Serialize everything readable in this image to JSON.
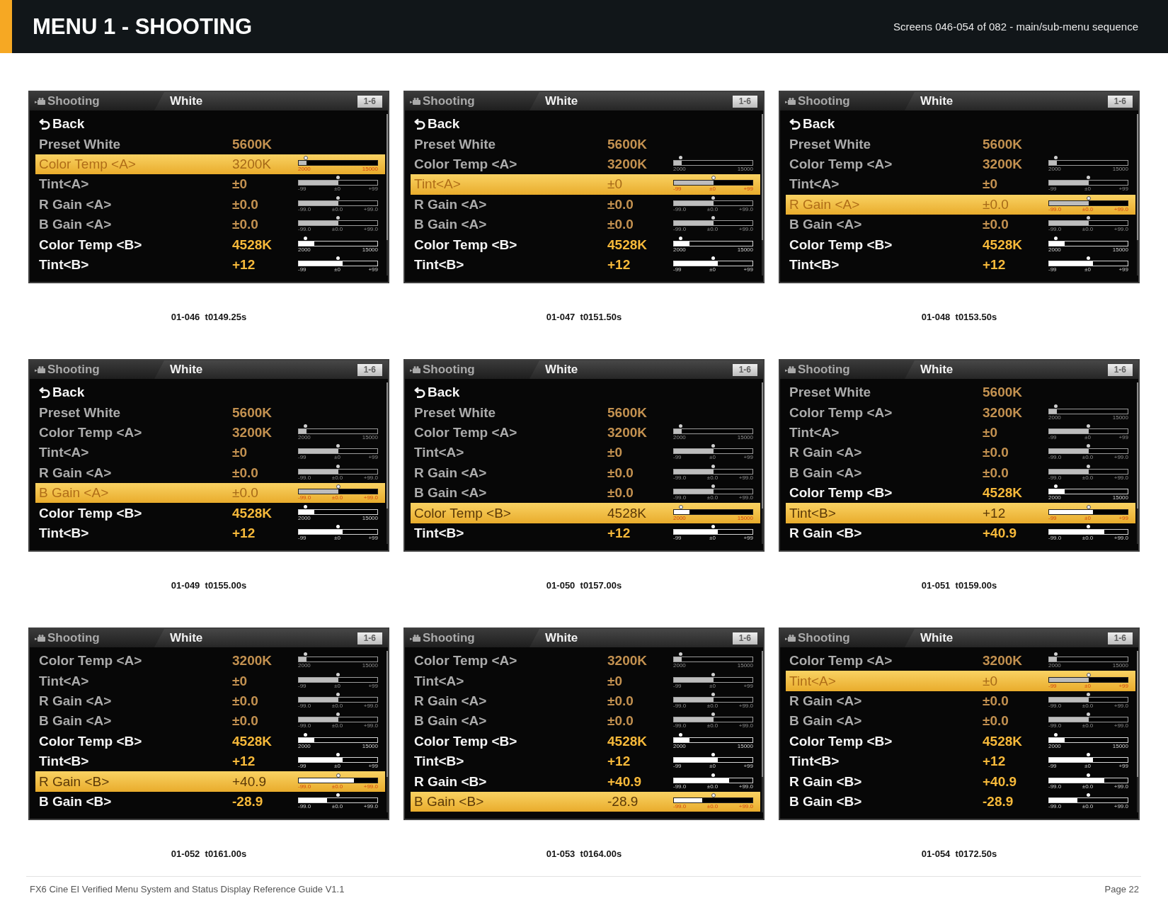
{
  "header": {
    "title": "MENU 1 - SHOOTING",
    "subtitle": "Screens 046-054 of 082 - main/sub-menu sequence"
  },
  "screens": [
    {
      "breadcrumb": "Shooting",
      "title": "White",
      "page": "1-6",
      "caption": "01-046  t0149.25s",
      "rows": [
        {
          "kind": "back",
          "label": "Back",
          "disabled": false,
          "selected": false
        },
        {
          "kind": "setting",
          "label": "Preset White",
          "value": "5600K",
          "disabled": true,
          "selected": false
        },
        {
          "kind": "setting",
          "label": "Color Temp <A>",
          "value": "3200K",
          "disabled": true,
          "selected": true,
          "slider": {
            "level": 0.1,
            "marker": {
              "level": 0.1
            },
            "ticks": [
              "2000",
              "15000"
            ]
          }
        },
        {
          "kind": "setting",
          "label": "Tint<A>",
          "value": "±0",
          "disabled": true,
          "selected": false,
          "slider": {
            "level": 0.5,
            "marker": {
              "level": 0.5
            },
            "ticks": [
              "-99",
              "±0",
              "+99"
            ]
          }
        },
        {
          "kind": "setting",
          "label": "R Gain <A>",
          "value": "±0.0",
          "disabled": true,
          "selected": false,
          "slider": {
            "level": 0.5,
            "marker": {
              "level": 0.5
            },
            "ticks": [
              "-99.0",
              "±0.0",
              "+99.0"
            ]
          }
        },
        {
          "kind": "setting",
          "label": "B Gain <A>",
          "value": "±0.0",
          "disabled": true,
          "selected": false,
          "slider": {
            "level": 0.5,
            "marker": {
              "level": 0.5
            },
            "ticks": [
              "-99.0",
              "±0.0",
              "+99.0"
            ]
          }
        },
        {
          "kind": "setting",
          "label": "Color Temp <B>",
          "value": "4528K",
          "disabled": false,
          "selected": false,
          "slider": {
            "level": 0.2,
            "marker": {
              "level": 0.1
            },
            "ticks": [
              "2000",
              "15000"
            ]
          }
        },
        {
          "kind": "setting",
          "label": "Tint<B>",
          "value": "+12",
          "disabled": false,
          "selected": false,
          "slider": {
            "level": 0.56,
            "marker": {
              "level": 0.5
            },
            "ticks": [
              "-99",
              "±0",
              "+99"
            ]
          }
        }
      ]
    },
    {
      "breadcrumb": "Shooting",
      "title": "White",
      "page": "1-6",
      "caption": "01-047  t0151.50s",
      "rows": [
        {
          "kind": "back",
          "label": "Back",
          "disabled": false,
          "selected": false
        },
        {
          "kind": "setting",
          "label": "Preset White",
          "value": "5600K",
          "disabled": true,
          "selected": false
        },
        {
          "kind": "setting",
          "label": "Color Temp <A>",
          "value": "3200K",
          "disabled": true,
          "selected": false,
          "slider": {
            "level": 0.1,
            "marker": {
              "level": 0.1
            },
            "ticks": [
              "2000",
              "15000"
            ]
          }
        },
        {
          "kind": "setting",
          "label": "Tint<A>",
          "value": "±0",
          "disabled": true,
          "selected": true,
          "slider": {
            "level": 0.5,
            "marker": {
              "level": 0.5
            },
            "ticks": [
              "-99",
              "±0",
              "+99"
            ]
          }
        },
        {
          "kind": "setting",
          "label": "R Gain <A>",
          "value": "±0.0",
          "disabled": true,
          "selected": false,
          "slider": {
            "level": 0.5,
            "marker": {
              "level": 0.5
            },
            "ticks": [
              "-99.0",
              "±0.0",
              "+99.0"
            ]
          }
        },
        {
          "kind": "setting",
          "label": "B Gain <A>",
          "value": "±0.0",
          "disabled": true,
          "selected": false,
          "slider": {
            "level": 0.5,
            "marker": {
              "level": 0.5
            },
            "ticks": [
              "-99.0",
              "±0.0",
              "+99.0"
            ]
          }
        },
        {
          "kind": "setting",
          "label": "Color Temp <B>",
          "value": "4528K",
          "disabled": false,
          "selected": false,
          "slider": {
            "level": 0.2,
            "marker": {
              "level": 0.1
            },
            "ticks": [
              "2000",
              "15000"
            ]
          }
        },
        {
          "kind": "setting",
          "label": "Tint<B>",
          "value": "+12",
          "disabled": false,
          "selected": false,
          "slider": {
            "level": 0.56,
            "marker": {
              "level": 0.5
            },
            "ticks": [
              "-99",
              "±0",
              "+99"
            ]
          }
        }
      ]
    },
    {
      "breadcrumb": "Shooting",
      "title": "White",
      "page": "1-6",
      "caption": "01-048  t0153.50s",
      "rows": [
        {
          "kind": "back",
          "label": "Back",
          "disabled": false,
          "selected": false
        },
        {
          "kind": "setting",
          "label": "Preset White",
          "value": "5600K",
          "disabled": true,
          "selected": false
        },
        {
          "kind": "setting",
          "label": "Color Temp <A>",
          "value": "3200K",
          "disabled": true,
          "selected": false,
          "slider": {
            "level": 0.1,
            "marker": {
              "level": 0.1
            },
            "ticks": [
              "2000",
              "15000"
            ]
          }
        },
        {
          "kind": "setting",
          "label": "Tint<A>",
          "value": "±0",
          "disabled": true,
          "selected": false,
          "slider": {
            "level": 0.5,
            "marker": {
              "level": 0.5
            },
            "ticks": [
              "-99",
              "±0",
              "+99"
            ]
          }
        },
        {
          "kind": "setting",
          "label": "R Gain <A>",
          "value": "±0.0",
          "disabled": true,
          "selected": true,
          "slider": {
            "level": 0.5,
            "marker": {
              "level": 0.5
            },
            "ticks": [
              "-99.0",
              "±0.0",
              "+99.0"
            ]
          }
        },
        {
          "kind": "setting",
          "label": "B Gain <A>",
          "value": "±0.0",
          "disabled": true,
          "selected": false,
          "slider": {
            "level": 0.5,
            "marker": {
              "level": 0.5
            },
            "ticks": [
              "-99.0",
              "±0.0",
              "+99.0"
            ]
          }
        },
        {
          "kind": "setting",
          "label": "Color Temp <B>",
          "value": "4528K",
          "disabled": false,
          "selected": false,
          "slider": {
            "level": 0.2,
            "marker": {
              "level": 0.1
            },
            "ticks": [
              "2000",
              "15000"
            ]
          }
        },
        {
          "kind": "setting",
          "label": "Tint<B>",
          "value": "+12",
          "disabled": false,
          "selected": false,
          "slider": {
            "level": 0.56,
            "marker": {
              "level": 0.5
            },
            "ticks": [
              "-99",
              "±0",
              "+99"
            ]
          }
        }
      ]
    },
    {
      "breadcrumb": "Shooting",
      "title": "White",
      "page": "1-6",
      "caption": "01-049  t0155.00s",
      "rows": [
        {
          "kind": "back",
          "label": "Back",
          "disabled": false,
          "selected": false
        },
        {
          "kind": "setting",
          "label": "Preset White",
          "value": "5600K",
          "disabled": true,
          "selected": false
        },
        {
          "kind": "setting",
          "label": "Color Temp <A>",
          "value": "3200K",
          "disabled": true,
          "selected": false,
          "slider": {
            "level": 0.1,
            "marker": {
              "level": 0.1
            },
            "ticks": [
              "2000",
              "15000"
            ]
          }
        },
        {
          "kind": "setting",
          "label": "Tint<A>",
          "value": "±0",
          "disabled": true,
          "selected": false,
          "slider": {
            "level": 0.5,
            "marker": {
              "level": 0.5
            },
            "ticks": [
              "-99",
              "±0",
              "+99"
            ]
          }
        },
        {
          "kind": "setting",
          "label": "R Gain <A>",
          "value": "±0.0",
          "disabled": true,
          "selected": false,
          "slider": {
            "level": 0.5,
            "marker": {
              "level": 0.5
            },
            "ticks": [
              "-99.0",
              "±0.0",
              "+99.0"
            ]
          }
        },
        {
          "kind": "setting",
          "label": "B Gain <A>",
          "value": "±0.0",
          "disabled": true,
          "selected": true,
          "slider": {
            "level": 0.5,
            "marker": {
              "level": 0.5
            },
            "ticks": [
              "-99.0",
              "±0.0",
              "+99.0"
            ]
          }
        },
        {
          "kind": "setting",
          "label": "Color Temp <B>",
          "value": "4528K",
          "disabled": false,
          "selected": false,
          "slider": {
            "level": 0.2,
            "marker": {
              "level": 0.1
            },
            "ticks": [
              "2000",
              "15000"
            ]
          }
        },
        {
          "kind": "setting",
          "label": "Tint<B>",
          "value": "+12",
          "disabled": false,
          "selected": false,
          "slider": {
            "level": 0.56,
            "marker": {
              "level": 0.5
            },
            "ticks": [
              "-99",
              "±0",
              "+99"
            ]
          }
        }
      ]
    },
    {
      "breadcrumb": "Shooting",
      "title": "White",
      "page": "1-6",
      "caption": "01-050  t0157.00s",
      "rows": [
        {
          "kind": "back",
          "label": "Back",
          "disabled": false,
          "selected": false
        },
        {
          "kind": "setting",
          "label": "Preset White",
          "value": "5600K",
          "disabled": true,
          "selected": false
        },
        {
          "kind": "setting",
          "label": "Color Temp <A>",
          "value": "3200K",
          "disabled": true,
          "selected": false,
          "slider": {
            "level": 0.1,
            "marker": {
              "level": 0.1
            },
            "ticks": [
              "2000",
              "15000"
            ]
          }
        },
        {
          "kind": "setting",
          "label": "Tint<A>",
          "value": "±0",
          "disabled": true,
          "selected": false,
          "slider": {
            "level": 0.5,
            "marker": {
              "level": 0.5
            },
            "ticks": [
              "-99",
              "±0",
              "+99"
            ]
          }
        },
        {
          "kind": "setting",
          "label": "R Gain <A>",
          "value": "±0.0",
          "disabled": true,
          "selected": false,
          "slider": {
            "level": 0.5,
            "marker": {
              "level": 0.5
            },
            "ticks": [
              "-99.0",
              "±0.0",
              "+99.0"
            ]
          }
        },
        {
          "kind": "setting",
          "label": "B Gain <A>",
          "value": "±0.0",
          "disabled": true,
          "selected": false,
          "slider": {
            "level": 0.5,
            "marker": {
              "level": 0.5
            },
            "ticks": [
              "-99.0",
              "±0.0",
              "+99.0"
            ]
          }
        },
        {
          "kind": "setting",
          "label": "Color Temp <B>",
          "value": "4528K",
          "disabled": false,
          "selected": true,
          "slider": {
            "level": 0.2,
            "marker": {
              "level": 0.1
            },
            "ticks": [
              "2000",
              "15000"
            ]
          }
        },
        {
          "kind": "setting",
          "label": "Tint<B>",
          "value": "+12",
          "disabled": false,
          "selected": false,
          "slider": {
            "level": 0.56,
            "marker": {
              "level": 0.5
            },
            "ticks": [
              "-99",
              "±0",
              "+99"
            ]
          }
        }
      ]
    },
    {
      "breadcrumb": "Shooting",
      "title": "White",
      "page": "1-6",
      "caption": "01-051  t0159.00s",
      "rows": [
        {
          "kind": "setting",
          "label": "Preset White",
          "value": "5600K",
          "disabled": true,
          "selected": false
        },
        {
          "kind": "setting",
          "label": "Color Temp <A>",
          "value": "3200K",
          "disabled": true,
          "selected": false,
          "slider": {
            "level": 0.1,
            "marker": {
              "level": 0.1
            },
            "ticks": [
              "2000",
              "15000"
            ]
          }
        },
        {
          "kind": "setting",
          "label": "Tint<A>",
          "value": "±0",
          "disabled": true,
          "selected": false,
          "slider": {
            "level": 0.5,
            "marker": {
              "level": 0.5
            },
            "ticks": [
              "-99",
              "±0",
              "+99"
            ]
          }
        },
        {
          "kind": "setting",
          "label": "R Gain <A>",
          "value": "±0.0",
          "disabled": true,
          "selected": false,
          "slider": {
            "level": 0.5,
            "marker": {
              "level": 0.5
            },
            "ticks": [
              "-99.0",
              "±0.0",
              "+99.0"
            ]
          }
        },
        {
          "kind": "setting",
          "label": "B Gain <A>",
          "value": "±0.0",
          "disabled": true,
          "selected": false,
          "slider": {
            "level": 0.5,
            "marker": {
              "level": 0.5
            },
            "ticks": [
              "-99.0",
              "±0.0",
              "+99.0"
            ]
          }
        },
        {
          "kind": "setting",
          "label": "Color Temp <B>",
          "value": "4528K",
          "disabled": false,
          "selected": false,
          "slider": {
            "level": 0.2,
            "marker": {
              "level": 0.1
            },
            "ticks": [
              "2000",
              "15000"
            ]
          }
        },
        {
          "kind": "setting",
          "label": "Tint<B>",
          "value": "+12",
          "disabled": false,
          "selected": true,
          "slider": {
            "level": 0.56,
            "marker": {
              "level": 0.5
            },
            "ticks": [
              "-99",
              "±0",
              "+99"
            ]
          }
        },
        {
          "kind": "setting",
          "label": "R Gain <B>",
          "value": "+40.9",
          "disabled": false,
          "selected": false,
          "slider": {
            "level": 0.7,
            "marker": {
              "level": 0.5
            },
            "ticks": [
              "-99.0",
              "±0.0",
              "+99.0"
            ]
          }
        }
      ]
    },
    {
      "breadcrumb": "Shooting",
      "title": "White",
      "page": "1-6",
      "caption": "01-052  t0161.00s",
      "rows": [
        {
          "kind": "setting",
          "label": "Color Temp <A>",
          "value": "3200K",
          "disabled": true,
          "selected": false,
          "slider": {
            "level": 0.1,
            "marker": {
              "level": 0.1
            },
            "ticks": [
              "2000",
              "15000"
            ]
          }
        },
        {
          "kind": "setting",
          "label": "Tint<A>",
          "value": "±0",
          "disabled": true,
          "selected": false,
          "slider": {
            "level": 0.5,
            "marker": {
              "level": 0.5
            },
            "ticks": [
              "-99",
              "±0",
              "+99"
            ]
          }
        },
        {
          "kind": "setting",
          "label": "R Gain <A>",
          "value": "±0.0",
          "disabled": true,
          "selected": false,
          "slider": {
            "level": 0.5,
            "marker": {
              "level": 0.5
            },
            "ticks": [
              "-99.0",
              "±0.0",
              "+99.0"
            ]
          }
        },
        {
          "kind": "setting",
          "label": "B Gain <A>",
          "value": "±0.0",
          "disabled": true,
          "selected": false,
          "slider": {
            "level": 0.5,
            "marker": {
              "level": 0.5
            },
            "ticks": [
              "-99.0",
              "±0.0",
              "+99.0"
            ]
          }
        },
        {
          "kind": "setting",
          "label": "Color Temp <B>",
          "value": "4528K",
          "disabled": false,
          "selected": false,
          "slider": {
            "level": 0.2,
            "marker": {
              "level": 0.1
            },
            "ticks": [
              "2000",
              "15000"
            ]
          }
        },
        {
          "kind": "setting",
          "label": "Tint<B>",
          "value": "+12",
          "disabled": false,
          "selected": false,
          "slider": {
            "level": 0.56,
            "marker": {
              "level": 0.5
            },
            "ticks": [
              "-99",
              "±0",
              "+99"
            ]
          }
        },
        {
          "kind": "setting",
          "label": "R Gain <B>",
          "value": "+40.9",
          "disabled": false,
          "selected": true,
          "slider": {
            "level": 0.7,
            "marker": {
              "level": 0.5
            },
            "ticks": [
              "-99.0",
              "±0.0",
              "+99.0"
            ]
          }
        },
        {
          "kind": "setting",
          "label": "B Gain <B>",
          "value": "-28.9",
          "disabled": false,
          "selected": false,
          "slider": {
            "level": 0.36,
            "marker": {
              "level": 0.5
            },
            "ticks": [
              "-99.0",
              "±0.0",
              "+99.0"
            ]
          }
        }
      ]
    },
    {
      "breadcrumb": "Shooting",
      "title": "White",
      "page": "1-6",
      "caption": "01-053  t0164.00s",
      "rows": [
        {
          "kind": "setting",
          "label": "Color Temp <A>",
          "value": "3200K",
          "disabled": true,
          "selected": false,
          "slider": {
            "level": 0.1,
            "marker": {
              "level": 0.1
            },
            "ticks": [
              "2000",
              "15000"
            ]
          }
        },
        {
          "kind": "setting",
          "label": "Tint<A>",
          "value": "±0",
          "disabled": true,
          "selected": false,
          "slider": {
            "level": 0.5,
            "marker": {
              "level": 0.5
            },
            "ticks": [
              "-99",
              "±0",
              "+99"
            ]
          }
        },
        {
          "kind": "setting",
          "label": "R Gain <A>",
          "value": "±0.0",
          "disabled": true,
          "selected": false,
          "slider": {
            "level": 0.5,
            "marker": {
              "level": 0.5
            },
            "ticks": [
              "-99.0",
              "±0.0",
              "+99.0"
            ]
          }
        },
        {
          "kind": "setting",
          "label": "B Gain <A>",
          "value": "±0.0",
          "disabled": true,
          "selected": false,
          "slider": {
            "level": 0.5,
            "marker": {
              "level": 0.5
            },
            "ticks": [
              "-99.0",
              "±0.0",
              "+99.0"
            ]
          }
        },
        {
          "kind": "setting",
          "label": "Color Temp <B>",
          "value": "4528K",
          "disabled": false,
          "selected": false,
          "slider": {
            "level": 0.2,
            "marker": {
              "level": 0.1
            },
            "ticks": [
              "2000",
              "15000"
            ]
          }
        },
        {
          "kind": "setting",
          "label": "Tint<B>",
          "value": "+12",
          "disabled": false,
          "selected": false,
          "slider": {
            "level": 0.56,
            "marker": {
              "level": 0.5
            },
            "ticks": [
              "-99",
              "±0",
              "+99"
            ]
          }
        },
        {
          "kind": "setting",
          "label": "R Gain <B>",
          "value": "+40.9",
          "disabled": false,
          "selected": false,
          "slider": {
            "level": 0.7,
            "marker": {
              "level": 0.5
            },
            "ticks": [
              "-99.0",
              "±0.0",
              "+99.0"
            ]
          }
        },
        {
          "kind": "setting",
          "label": "B Gain <B>",
          "value": "-28.9",
          "disabled": false,
          "selected": true,
          "slider": {
            "level": 0.36,
            "marker": {
              "level": 0.5
            },
            "ticks": [
              "-99.0",
              "±0.0",
              "+99.0"
            ]
          }
        }
      ]
    },
    {
      "breadcrumb": "Shooting",
      "title": "White",
      "page": "1-6",
      "caption": "01-054  t0172.50s",
      "rows": [
        {
          "kind": "setting",
          "label": "Color Temp <A>",
          "value": "3200K",
          "disabled": true,
          "selected": false,
          "slider": {
            "level": 0.1,
            "marker": {
              "level": 0.1
            },
            "ticks": [
              "2000",
              "15000"
            ]
          }
        },
        {
          "kind": "setting",
          "label": "Tint<A>",
          "value": "±0",
          "disabled": true,
          "selected": true,
          "slider": {
            "level": 0.5,
            "marker": {
              "level": 0.5
            },
            "ticks": [
              "-99",
              "±0",
              "+99"
            ]
          }
        },
        {
          "kind": "setting",
          "label": "R Gain <A>",
          "value": "±0.0",
          "disabled": true,
          "selected": false,
          "slider": {
            "level": 0.5,
            "marker": {
              "level": 0.5
            },
            "ticks": [
              "-99.0",
              "±0.0",
              "+99.0"
            ]
          }
        },
        {
          "kind": "setting",
          "label": "B Gain <A>",
          "value": "±0.0",
          "disabled": true,
          "selected": false,
          "slider": {
            "level": 0.5,
            "marker": {
              "level": 0.5
            },
            "ticks": [
              "-99.0",
              "±0.0",
              "+99.0"
            ]
          }
        },
        {
          "kind": "setting",
          "label": "Color Temp <B>",
          "value": "4528K",
          "disabled": false,
          "selected": false,
          "slider": {
            "level": 0.2,
            "marker": {
              "level": 0.1
            },
            "ticks": [
              "2000",
              "15000"
            ]
          }
        },
        {
          "kind": "setting",
          "label": "Tint<B>",
          "value": "+12",
          "disabled": false,
          "selected": false,
          "slider": {
            "level": 0.56,
            "marker": {
              "level": 0.5
            },
            "ticks": [
              "-99",
              "±0",
              "+99"
            ]
          }
        },
        {
          "kind": "setting",
          "label": "R Gain <B>",
          "value": "+40.9",
          "disabled": false,
          "selected": false,
          "slider": {
            "level": 0.7,
            "marker": {
              "level": 0.5
            },
            "ticks": [
              "-99.0",
              "±0.0",
              "+99.0"
            ]
          }
        },
        {
          "kind": "setting",
          "label": "B Gain <B>",
          "value": "-28.9",
          "disabled": false,
          "selected": false,
          "slider": {
            "level": 0.36,
            "marker": {
              "level": 0.5
            },
            "ticks": [
              "-99.0",
              "±0.0",
              "+99.0"
            ]
          }
        }
      ]
    }
  ],
  "footer": {
    "text": "FX6 Cine EI Verified Menu System and Status Display Reference Guide V1.1",
    "page": "Page 22"
  }
}
